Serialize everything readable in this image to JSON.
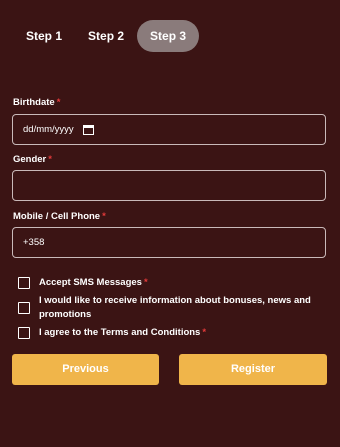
{
  "steps": [
    {
      "label": "Step 1"
    },
    {
      "label": "Step 2"
    },
    {
      "label": "Step 3"
    }
  ],
  "birthdate": {
    "label": "Birthdate",
    "required_mark": "*",
    "value": "dd/mm/yyyy",
    "icon": "calendar-icon"
  },
  "gender": {
    "label": "Gender",
    "required_mark": "*",
    "value": ""
  },
  "phone": {
    "label": "Mobile / Cell Phone",
    "required_mark": "*",
    "value": "+358"
  },
  "checkboxes": [
    {
      "label": "Accept SMS Messages",
      "required_mark": "*"
    },
    {
      "label": "I would like to receive information about bonuses, news and promotions",
      "required_mark": ""
    },
    {
      "label": "I agree to the Terms and Conditions",
      "required_mark": "*"
    }
  ],
  "buttons": {
    "previous": "Previous",
    "register": "Register"
  },
  "colors": {
    "background": "#3b1414",
    "accent": "#f0b54a",
    "active_step": "#8a7b7b",
    "required": "#e23a3a"
  }
}
